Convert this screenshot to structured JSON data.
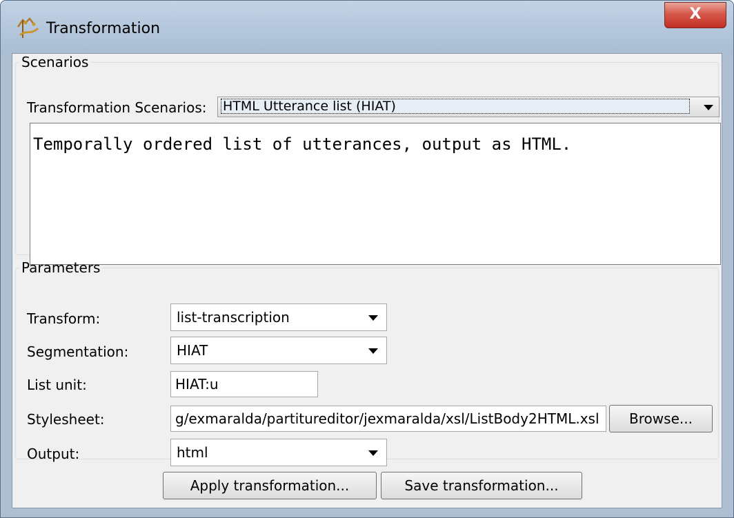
{
  "window": {
    "title": "Transformation",
    "close_label": "X"
  },
  "scenarios": {
    "legend": "Scenarios",
    "label": "Transformation Scenarios:",
    "selected": "HTML Utterance list (HIAT)",
    "description": "Temporally ordered list of utterances, output as HTML."
  },
  "parameters": {
    "legend": "Parameters",
    "transform": {
      "label": "Transform:",
      "value": "list-transcription"
    },
    "segmentation": {
      "label": "Segmentation:",
      "value": "HIAT"
    },
    "list_unit": {
      "label": "List unit:",
      "value": "HIAT:u"
    },
    "stylesheet": {
      "label": "Stylesheet:",
      "value": "g/exmaralda/partitureditor/jexmaralda/xsl/ListBody2HTML.xsl",
      "browse_label": "Browse..."
    },
    "output": {
      "label": "Output:",
      "value": "html"
    }
  },
  "actions": {
    "apply_label": "Apply transformation...",
    "save_label": "Save transformation..."
  },
  "colors": {
    "close_button": "#c9392b",
    "titlebar": "#b7c9dd",
    "panel": "#f0f0f0"
  }
}
